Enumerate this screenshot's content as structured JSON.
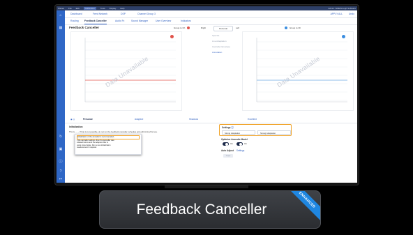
{
  "window": {
    "app_name": "Waves",
    "menu": [
      "File",
      "Edit",
      "Calibration",
      "Tools",
      "Display",
      "Help"
    ],
    "menu_active_index": 2,
    "right_text": "Admin: Walkthrough Software"
  },
  "top_tabs": {
    "items": [
      "Dashboard",
      "Feed Network",
      "DSP",
      "Channel Group 3"
    ],
    "right_status": "APPLY ALL",
    "right_link": "Undo"
  },
  "sub_nav": {
    "items": [
      "Routing",
      "Feedback Canceller",
      "Audio Fx",
      "Sound Manager",
      "User Overview",
      "Indicators"
    ],
    "active_index": 1
  },
  "page_title": "Feedback Canceller",
  "left_chart": {
    "header_label": "Group to Ch",
    "watermark": "Data Unavailable",
    "line_color": "#e0524a"
  },
  "right_chart": {
    "header_label": "Group to Ch",
    "watermark": "Data Unavailable",
    "line_color": "#6aa6e0"
  },
  "mid_controls": {
    "label_left": "Right",
    "pill": "Personal",
    "label_right": "Left",
    "items": [
      "Spectra",
      "Live Adaptation",
      "Canceller Envelope",
      "Annotation"
    ],
    "active_item_index": 3
  },
  "bottom_tabs": {
    "items": [
      "Personal",
      "Adaptive",
      "Shadows",
      "Excellent"
    ],
    "active_index": 0
  },
  "initialization": {
    "title": "Initialization",
    "text": "This is ... ... If that is not possible, do not run the feedback canceller; schedule and edit during first use."
  },
  "popup": {
    "lines": [
      "Initialization of the canceller is recommended...",
      "if the canceller settings, then the canceller was",
      "initiated before and the adaptive filter is",
      "using stored state. Run a new initialization",
      "measurement if required."
    ]
  },
  "settings": {
    "title": "Settings",
    "select_left": "Strong Adaptation",
    "select_right": "Strong Adaptation"
  },
  "acoustic": {
    "title": "Optimize Acoustic Model",
    "toggle_left_label": "On",
    "toggle_right_label": "On"
  },
  "auto_adjust": {
    "label": "Auto Adjust",
    "link": "Settings",
    "button": "Apply"
  },
  "caption": {
    "title": "Feedback Canceller",
    "badge": "ENHANCED"
  },
  "colors": {
    "accent": "#3564c2",
    "rail": "#2f67c6",
    "highlight": "#f0a42a",
    "badge": "#1f86e0"
  }
}
